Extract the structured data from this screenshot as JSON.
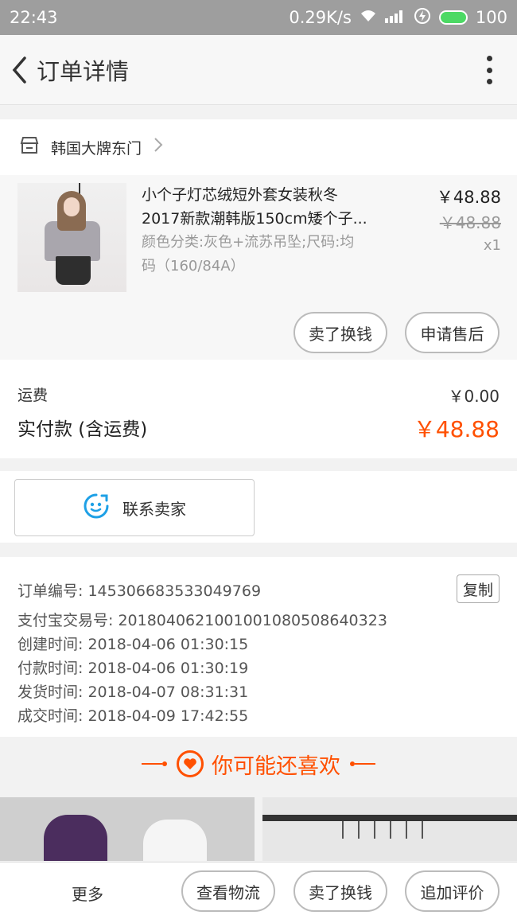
{
  "status_bar": {
    "time": "22:43",
    "speed": "0.29K/s",
    "battery": "100",
    "battery_color": "#4cd964"
  },
  "header": {
    "title": "订单详情"
  },
  "shop": {
    "name": "韩国大牌东门",
    "icon": "shop-icon"
  },
  "product": {
    "title": "小个子灯芯绒短外套女装秋冬2017新款潮韩版150cm矮个子...",
    "title_line1": "小个子灯芯绒短外套女装秋冬",
    "title_line2": "2017新款潮韩版150cm矮个子...",
    "attr_line1": "颜色分类:灰色+流苏吊坠;尺码:均",
    "attr_line2": "码（160/84A）",
    "price": "￥48.88",
    "original_price": "￥48.88",
    "quantity": "x1",
    "btn_resell": "卖了换钱",
    "btn_aftersale": "申请售后"
  },
  "fees": {
    "shipping_label": "运费",
    "shipping_value": "￥0.00",
    "paid_label": "实付款 (含运费)",
    "paid_value": "￥48.88",
    "accent_color": "#ff5000"
  },
  "contact": {
    "label": "联系卖家",
    "icon": "chat-face-icon"
  },
  "order_info": {
    "order_no": "订单编号: 1453066835330497​69",
    "copy_label": "复制",
    "alipay_no": "支付宝交易号: 2018040621001001080508640323",
    "created": "创建时间: 2018-04-06 01:30:15",
    "paid": "付款时间: 2018-04-06 01:30:19",
    "shipped": "发货时间: 2018-04-07 08:31:31",
    "completed": "成交时间: 2018-04-09 17:42:55"
  },
  "recommend": {
    "title": "你可能还喜欢",
    "icon": "heart-icon"
  },
  "bottom_bar": {
    "more": "更多",
    "logistics": "查看物流",
    "resell": "卖了换钱",
    "review": "追加评价"
  }
}
